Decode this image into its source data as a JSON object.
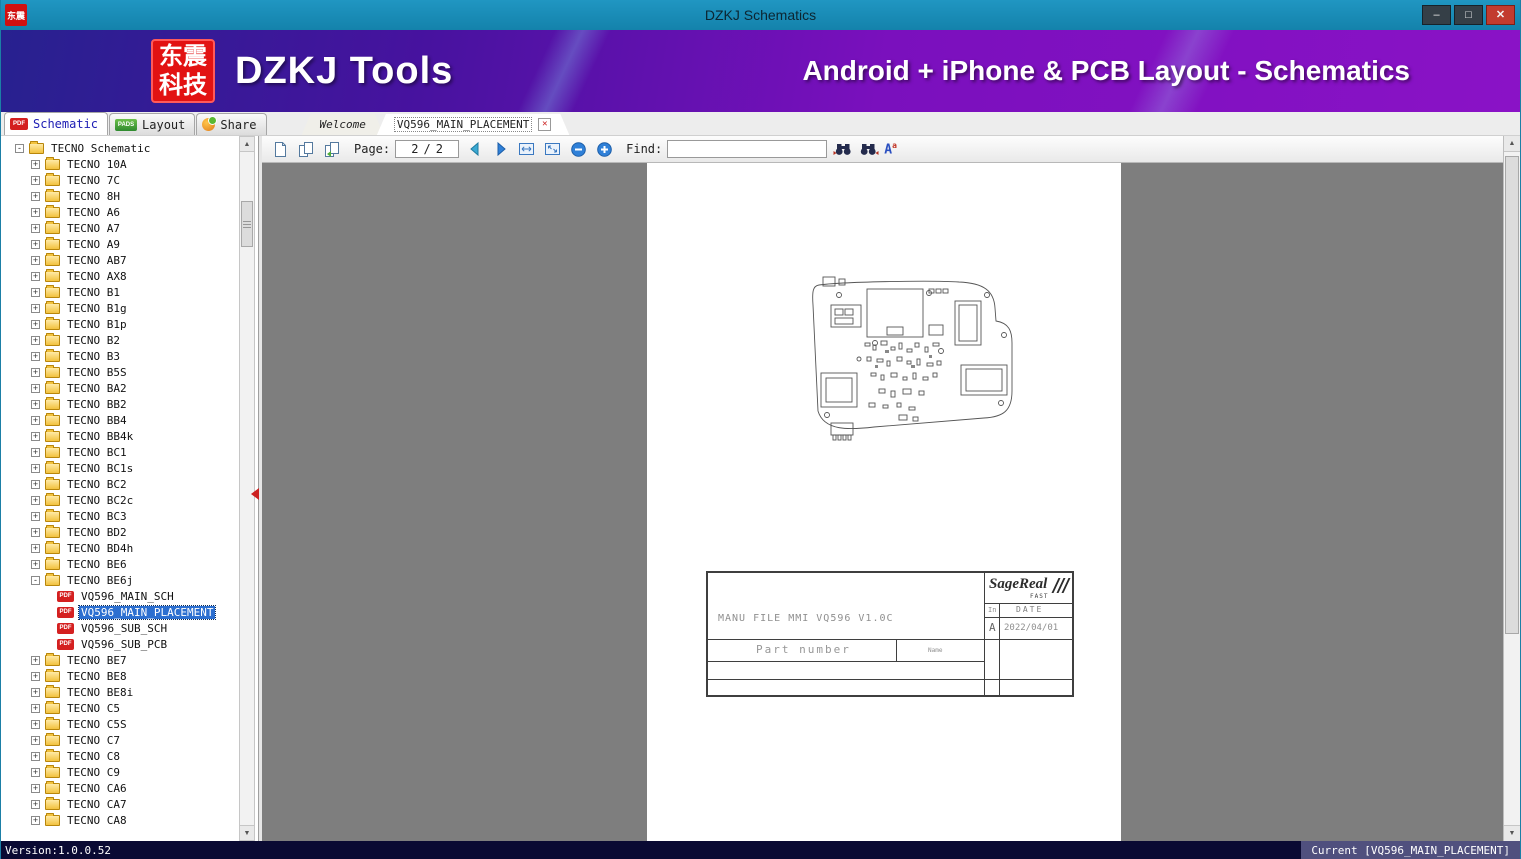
{
  "window": {
    "title": "DZKJ Schematics",
    "icon_text": "东",
    "controls": {
      "minimize": "–",
      "maximize": "□",
      "close": "✕"
    }
  },
  "banner": {
    "logo_line1": "东震",
    "logo_line2": "科技",
    "brand": "DZKJ Tools",
    "subtitle": "Android + iPhone & PCB Layout - Schematics"
  },
  "tabs": {
    "app": [
      {
        "label": "Schematic"
      },
      {
        "label": "Layout"
      },
      {
        "label": "Share"
      }
    ],
    "docs": [
      {
        "label": "Welcome"
      },
      {
        "label": "VQ596_MAIN_PLACEMENT"
      }
    ],
    "close_glyph": "✕"
  },
  "icons": {
    "pdf_badge": "PDF",
    "pads_badge": "PADS",
    "case_main": "A",
    "case_sup": "a",
    "scroll_up": "▲",
    "scroll_down": "▼"
  },
  "toolbar": {
    "page_label": "Page:",
    "page_value": "2",
    "page_separator": "/",
    "page_total": "2",
    "find_label": "Find:",
    "find_value": ""
  },
  "sidebar": {
    "tree": [
      {
        "label": "TECNO Schematic",
        "level": 0,
        "kind": "folder",
        "expander": "-"
      },
      {
        "label": "TECNO 10A",
        "level": 1,
        "kind": "folder",
        "expander": "+"
      },
      {
        "label": "TECNO 7C",
        "level": 1,
        "kind": "folder",
        "expander": "+"
      },
      {
        "label": "TECNO 8H",
        "level": 1,
        "kind": "folder",
        "expander": "+"
      },
      {
        "label": "TECNO A6",
        "level": 1,
        "kind": "folder",
        "expander": "+"
      },
      {
        "label": "TECNO A7",
        "level": 1,
        "kind": "folder",
        "expander": "+"
      },
      {
        "label": "TECNO A9",
        "level": 1,
        "kind": "folder",
        "expander": "+"
      },
      {
        "label": "TECNO AB7",
        "level": 1,
        "kind": "folder",
        "expander": "+"
      },
      {
        "label": "TECNO AX8",
        "level": 1,
        "kind": "folder",
        "expander": "+"
      },
      {
        "label": "TECNO B1",
        "level": 1,
        "kind": "folder",
        "expander": "+"
      },
      {
        "label": "TECNO B1g",
        "level": 1,
        "kind": "folder",
        "expander": "+"
      },
      {
        "label": "TECNO B1p",
        "level": 1,
        "kind": "folder",
        "expander": "+"
      },
      {
        "label": "TECNO B2",
        "level": 1,
        "kind": "folder",
        "expander": "+"
      },
      {
        "label": "TECNO B3",
        "level": 1,
        "kind": "folder",
        "expander": "+"
      },
      {
        "label": "TECNO B5S",
        "level": 1,
        "kind": "folder",
        "expander": "+"
      },
      {
        "label": "TECNO BA2",
        "level": 1,
        "kind": "folder",
        "expander": "+"
      },
      {
        "label": "TECNO BB2",
        "level": 1,
        "kind": "folder",
        "expander": "+"
      },
      {
        "label": "TECNO BB4",
        "level": 1,
        "kind": "folder",
        "expander": "+"
      },
      {
        "label": "TECNO BB4k",
        "level": 1,
        "kind": "folder",
        "expander": "+"
      },
      {
        "label": "TECNO BC1",
        "level": 1,
        "kind": "folder",
        "expander": "+"
      },
      {
        "label": "TECNO BC1s",
        "level": 1,
        "kind": "folder",
        "expander": "+"
      },
      {
        "label": "TECNO BC2",
        "level": 1,
        "kind": "folder",
        "expander": "+"
      },
      {
        "label": "TECNO BC2c",
        "level": 1,
        "kind": "folder",
        "expander": "+"
      },
      {
        "label": "TECNO BC3",
        "level": 1,
        "kind": "folder",
        "expander": "+"
      },
      {
        "label": "TECNO BD2",
        "level": 1,
        "kind": "folder",
        "expander": "+"
      },
      {
        "label": "TECNO BD4h",
        "level": 1,
        "kind": "folder",
        "expander": "+"
      },
      {
        "label": "TECNO BE6",
        "level": 1,
        "kind": "folder",
        "expander": "+"
      },
      {
        "label": "TECNO BE6j",
        "level": 1,
        "kind": "folder",
        "expander": "-"
      },
      {
        "label": "VQ596_MAIN_SCH",
        "level": 2,
        "kind": "pdf"
      },
      {
        "label": "VQ596_MAIN_PLACEMENT",
        "level": 2,
        "kind": "pdf",
        "selected": true
      },
      {
        "label": "VQ596_SUB_SCH",
        "level": 2,
        "kind": "pdf"
      },
      {
        "label": "VQ596_SUB_PCB",
        "level": 2,
        "kind": "pdf"
      },
      {
        "label": "TECNO BE7",
        "level": 1,
        "kind": "folder",
        "expander": "+"
      },
      {
        "label": "TECNO BE8",
        "level": 1,
        "kind": "folder",
        "expander": "+"
      },
      {
        "label": "TECNO BE8i",
        "level": 1,
        "kind": "folder",
        "expander": "+"
      },
      {
        "label": "TECNO C5",
        "level": 1,
        "kind": "folder",
        "expander": "+"
      },
      {
        "label": "TECNO C5S",
        "level": 1,
        "kind": "folder",
        "expander": "+"
      },
      {
        "label": "TECNO C7",
        "level": 1,
        "kind": "folder",
        "expander": "+"
      },
      {
        "label": "TECNO C8",
        "level": 1,
        "kind": "folder",
        "expander": "+"
      },
      {
        "label": "TECNO C9",
        "level": 1,
        "kind": "folder",
        "expander": "+"
      },
      {
        "label": "TECNO CA6",
        "level": 1,
        "kind": "folder",
        "expander": "+"
      },
      {
        "label": "TECNO CA7",
        "level": 1,
        "kind": "folder",
        "expander": "+"
      },
      {
        "label": "TECNO CA8",
        "level": 1,
        "kind": "folder",
        "expander": "+"
      }
    ]
  },
  "document": {
    "title_block": {
      "manu_file": "MANU FILE MMI  VQ596  V1.0C",
      "logo": "SageReal",
      "logo_sub": "FAST",
      "rev_header": "In",
      "date_header": "DATE",
      "rev_value": "A",
      "date_value": "2022/04/01",
      "part_number_label": "Part number",
      "name_label": "Name"
    }
  },
  "status": {
    "version": "Version:1.0.0.52",
    "current": "Current [VQ596_MAIN_PLACEMENT]"
  }
}
